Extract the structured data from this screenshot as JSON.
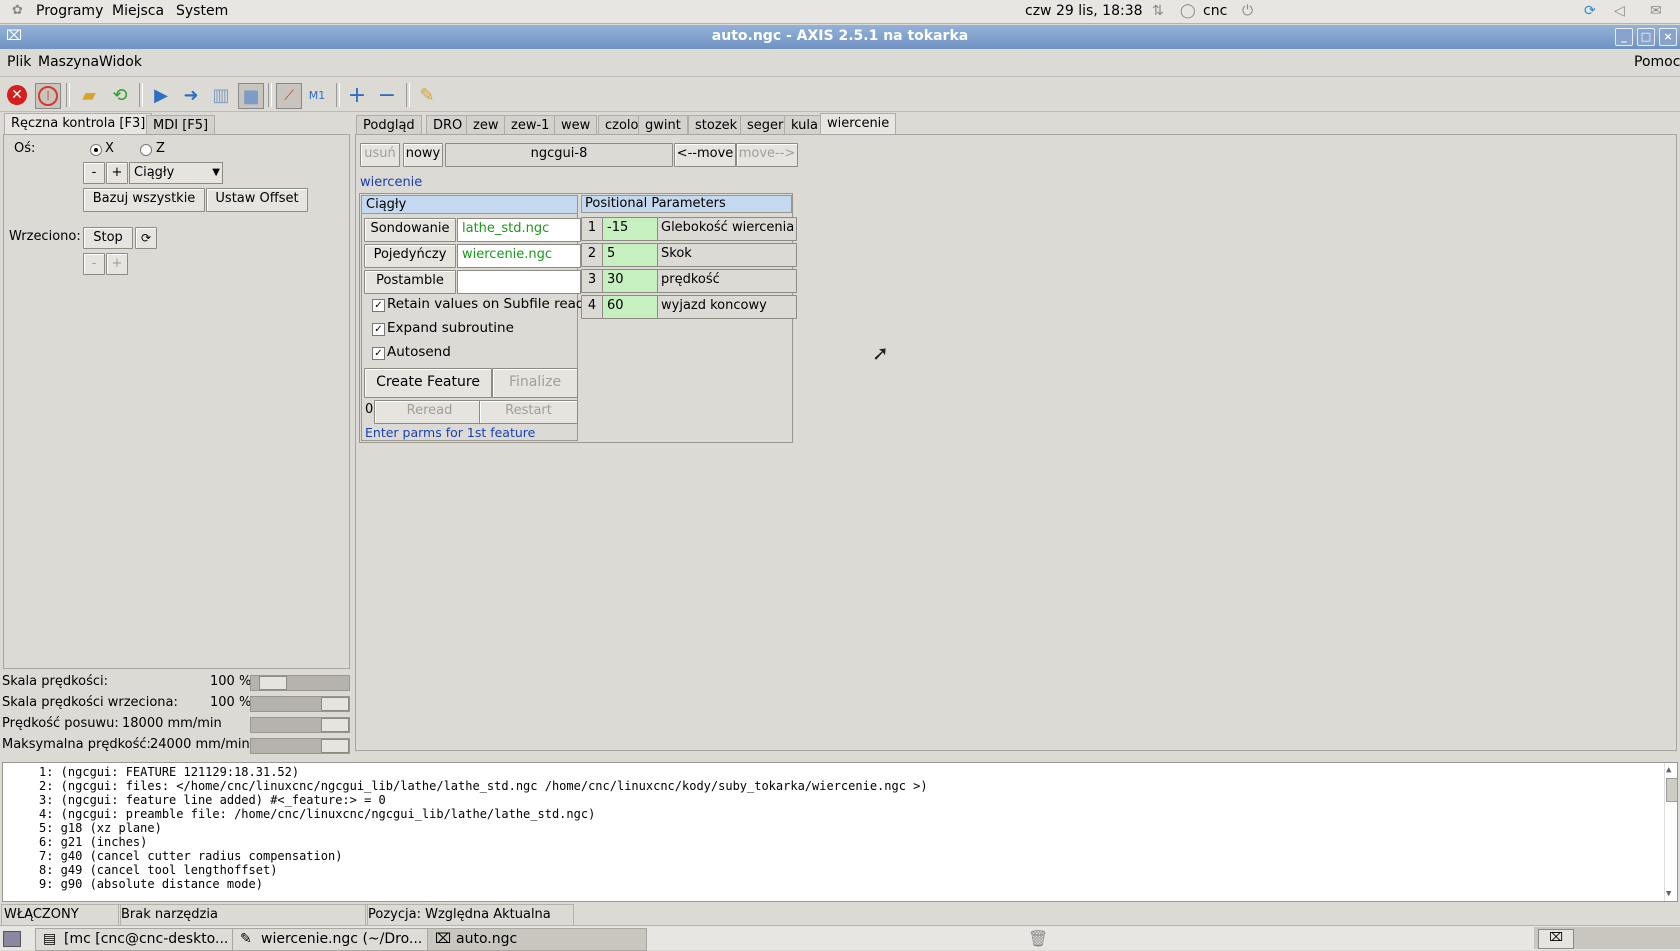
{
  "top_panel": {
    "menus": [
      "Programy",
      "Miejsca",
      "System"
    ],
    "clock": "czw 29 lis, 18:38",
    "user": "cnc"
  },
  "window": {
    "title": "auto.ngc - AXIS 2.5.1 na tokarka"
  },
  "menubar": {
    "items": [
      "Plik",
      "Maszyna",
      "Widok"
    ],
    "help": "Pomoc"
  },
  "left_tabs": [
    "Ręczna kontrola [F3]",
    "MDI [F5]"
  ],
  "manual": {
    "axis_label": "Oś:",
    "axis_x": "X",
    "axis_z": "Z",
    "minus": "-",
    "plus": "+",
    "jog_mode": "Ciągły",
    "home_all": "Bazuj wszystkie",
    "set_offset": "Ustaw Offset",
    "spindle_label": "Wrzeciono:",
    "spindle_stop": "Stop"
  },
  "overrides": [
    {
      "label": "Skala prędkości:",
      "value": "100 %",
      "level": 0.12
    },
    {
      "label": "Skala prędkości wrzeciona:",
      "value": "100 %",
      "level": 1.0
    },
    {
      "label": "Prędkość posuwu:",
      "value": "18000 mm/min",
      "level": 1.0
    },
    {
      "label": "Maksymalna prędkość:",
      "value": "24000 mm/min",
      "level": 1.0
    }
  ],
  "right_tabs": [
    "Podgląd",
    "DRO",
    "zew",
    "zew-1",
    "wew",
    "czolo",
    "gwint",
    "stozek",
    "seger",
    "kula",
    "wiercenie"
  ],
  "ngcgui": {
    "usun": "usuń",
    "nowy": "nowy",
    "page_name": "ngcgui-8",
    "move_left": "<--move",
    "move_right": "move-->",
    "section_title": "wiercenie",
    "mode_title": "Ciągły",
    "sondowanie": "Sondowanie",
    "sondowanie_file": "lathe_std.ngc",
    "pojedynczy": "Pojedyńczy",
    "pojedynczy_file": "wiercenie.ngc",
    "postamble": "Postamble",
    "postamble_file": "",
    "chk_retain": "Retain values on Subfile read",
    "chk_expand": "Expand subroutine",
    "chk_autosend": "Autosend",
    "create": "Create Feature",
    "finalize": "Finalize",
    "count": "0",
    "reread": "Reread",
    "restart": "Restart",
    "hint": "Enter parms for 1st feature",
    "params_title": "Positional Parameters",
    "params": [
      {
        "n": "1",
        "value": "-15",
        "name": "Glebokość wiercenia"
      },
      {
        "n": "2",
        "value": "5",
        "name": "Skok"
      },
      {
        "n": "3",
        "value": "30",
        "name": "prędkość"
      },
      {
        "n": "4",
        "value": "60",
        "name": "wyjazd koncowy"
      }
    ]
  },
  "console": [
    "1: (ngcgui: FEATURE 121129:18.31.52)",
    "2: (ngcgui: files: </home/cnc/linuxcnc/ngcgui_lib/lathe/lathe_std.ngc /home/cnc/linuxcnc/kody/suby_tokarka/wiercenie.ngc >)",
    "3: (ngcgui: feature line added) #<_feature:> = 0",
    "4: (ngcgui: preamble file: /home/cnc/linuxcnc/ngcgui_lib/lathe/lathe_std.ngc)",
    "5: g18 (xz plane)",
    "6: g21 (inches)",
    "7: g40 (cancel cutter radius compensation)",
    "8: g49 (cancel tool lengthoffset)",
    "9: g90 (absolute distance mode)"
  ],
  "status": {
    "state": "WŁĄCZONY",
    "tool": "Brak narzędzia",
    "position": "Pozycja: Względna Aktualna"
  },
  "taskbar": [
    "[mc [cnc@cnc-deskto...",
    "wiercenie.ngc (~/Dro...",
    "auto.ngc"
  ],
  "colors": {
    "title_bar": "#7f9fcc",
    "file_green": "#1a9a1a",
    "param_green": "#c6f0c0",
    "header_blue": "#c4d8f0",
    "link_blue": "#1b3fb0"
  }
}
